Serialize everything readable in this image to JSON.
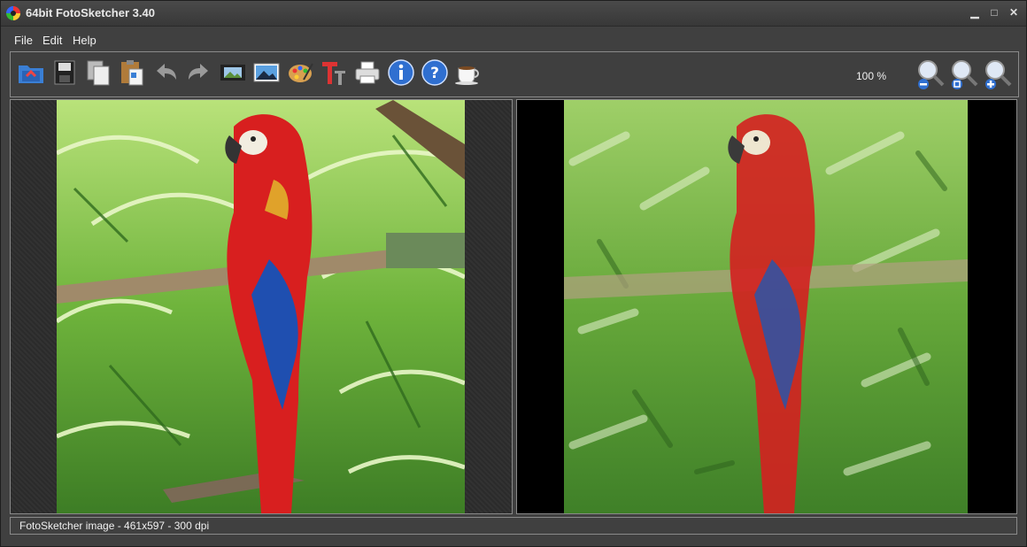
{
  "window": {
    "title": "64bit FotoSketcher 3.40",
    "minimize": "▁",
    "maximize": "□",
    "close": "✕"
  },
  "menu": {
    "items": [
      "File",
      "Edit",
      "Help"
    ]
  },
  "toolbar": {
    "buttons": [
      "open-folder-icon",
      "save-disk-icon",
      "copy-icon",
      "paste-icon",
      "undo-icon",
      "redo-icon",
      "filmstrip-icon",
      "landscape-image-icon",
      "palette-icon",
      "text-tool-icon",
      "printer-icon",
      "info-icon",
      "help-icon",
      "coffee-cup-icon"
    ],
    "zoom_level": "100 %",
    "zoom_buttons": [
      "zoom-out-icon",
      "zoom-fit-icon",
      "zoom-in-icon"
    ]
  },
  "status": {
    "text": "FotoSketcher image - 461x597 - 300 dpi"
  },
  "colors": {
    "background": "#404040",
    "border": "#8a8a8a",
    "parrot_red": "#d81f1f",
    "foliage": "#5da83a"
  }
}
